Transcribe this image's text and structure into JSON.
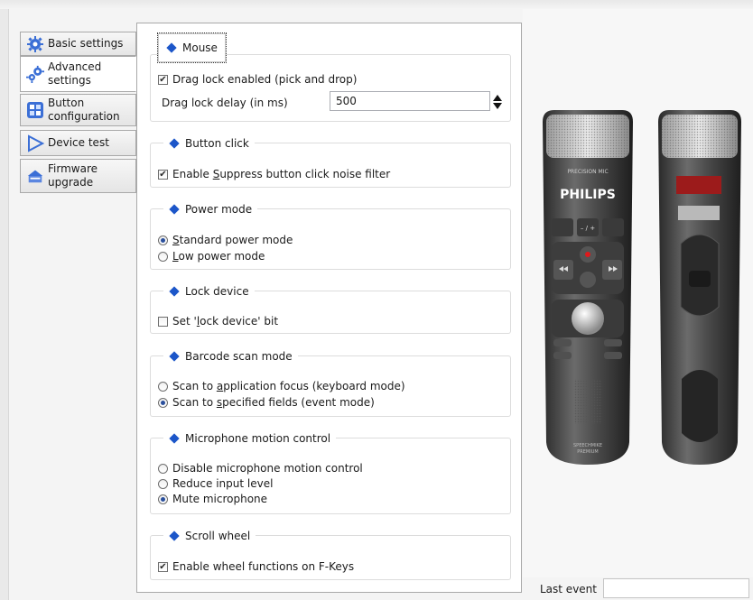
{
  "tabs": [
    {
      "label": "Basic settings",
      "icon": "gear-icon"
    },
    {
      "label": "Advanced settings",
      "icon": "gears-icon"
    },
    {
      "label": "Button configuration",
      "icon": "button-grid-icon"
    },
    {
      "label": "Device test",
      "icon": "play-triangle-icon"
    },
    {
      "label": "Firmware upgrade",
      "icon": "firmware-chip-icon"
    }
  ],
  "active_tab": "Advanced settings",
  "groups": {
    "mouse": {
      "title": "Mouse",
      "drag_lock_label": "Drag lock enabled (pick and drop)",
      "drag_lock_checked": true,
      "delay_label": "Drag lock delay (in ms)",
      "delay_value": "500"
    },
    "button_click": {
      "title": "Button click",
      "suppress_prefix": "Enable ",
      "suppress_u": "S",
      "suppress_rest": "uppress button click noise filter",
      "suppress_checked": true
    },
    "power_mode": {
      "title": "Power mode",
      "opt1_u": "S",
      "opt1_rest": "tandard power mode",
      "opt2_u": "L",
      "opt2_rest": "ow power mode",
      "selected": "Standard power mode"
    },
    "lock_device": {
      "title": "Lock device",
      "label_prefix": "Set '",
      "label_u": "l",
      "label_rest": "ock device' bit",
      "checked": false
    },
    "barcode": {
      "title": "Barcode scan mode",
      "opt1_prefix": "Scan to ",
      "opt1_u": "a",
      "opt1_rest": "pplication focus (keyboard mode)",
      "opt2_prefix": "Scan to ",
      "opt2_u": "s",
      "opt2_rest": "pecified fields (event mode)",
      "selected": "Scan to specified fields (event mode)"
    },
    "mic_motion": {
      "title": "Microphone motion control",
      "opt1": "Disable microphone motion control",
      "opt2": "Reduce input level",
      "opt3": "Mute microphone",
      "selected": "Mute microphone"
    },
    "scroll_wheel": {
      "title": "Scroll wheel",
      "label": "Enable wheel functions on F-Keys",
      "checked": true
    }
  },
  "device": {
    "mic_label": "PRECISION MIC",
    "brand": "PHILIPS",
    "btn_eol": "•EOL\n••PRIO",
    "btn_minus_plus": "– / +",
    "btn_ins": "INS/\nOVR",
    "fkeys": [
      "F1",
      "F2",
      "F3",
      "F4"
    ],
    "bottom_label": "SPEECHMIKE\nPREMIUM"
  },
  "last_event": {
    "label": "Last event",
    "value": ""
  },
  "colors": {
    "accent_blue": "#1c56c9",
    "record_red": "#e0191c"
  }
}
